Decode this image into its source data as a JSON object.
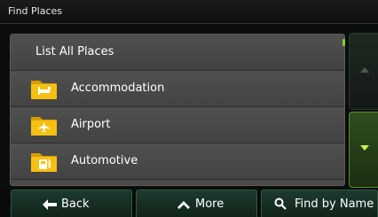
{
  "header": {
    "title": "Find Places"
  },
  "list": {
    "items": [
      {
        "label": "List All Places",
        "icon": null
      },
      {
        "label": "Accommodation",
        "icon": "bed-icon"
      },
      {
        "label": "Airport",
        "icon": "airplane-icon"
      },
      {
        "label": "Automotive",
        "icon": "fuel-pump-icon"
      }
    ]
  },
  "toolbar": {
    "back_label": "Back",
    "more_label": "More",
    "find_by_name_label": "Find by Name"
  },
  "colors": {
    "accent": "#7ad81c",
    "folder": "#f5c012",
    "button_bg": "#1d3a2e",
    "list_bg": "#4a4a4a"
  }
}
